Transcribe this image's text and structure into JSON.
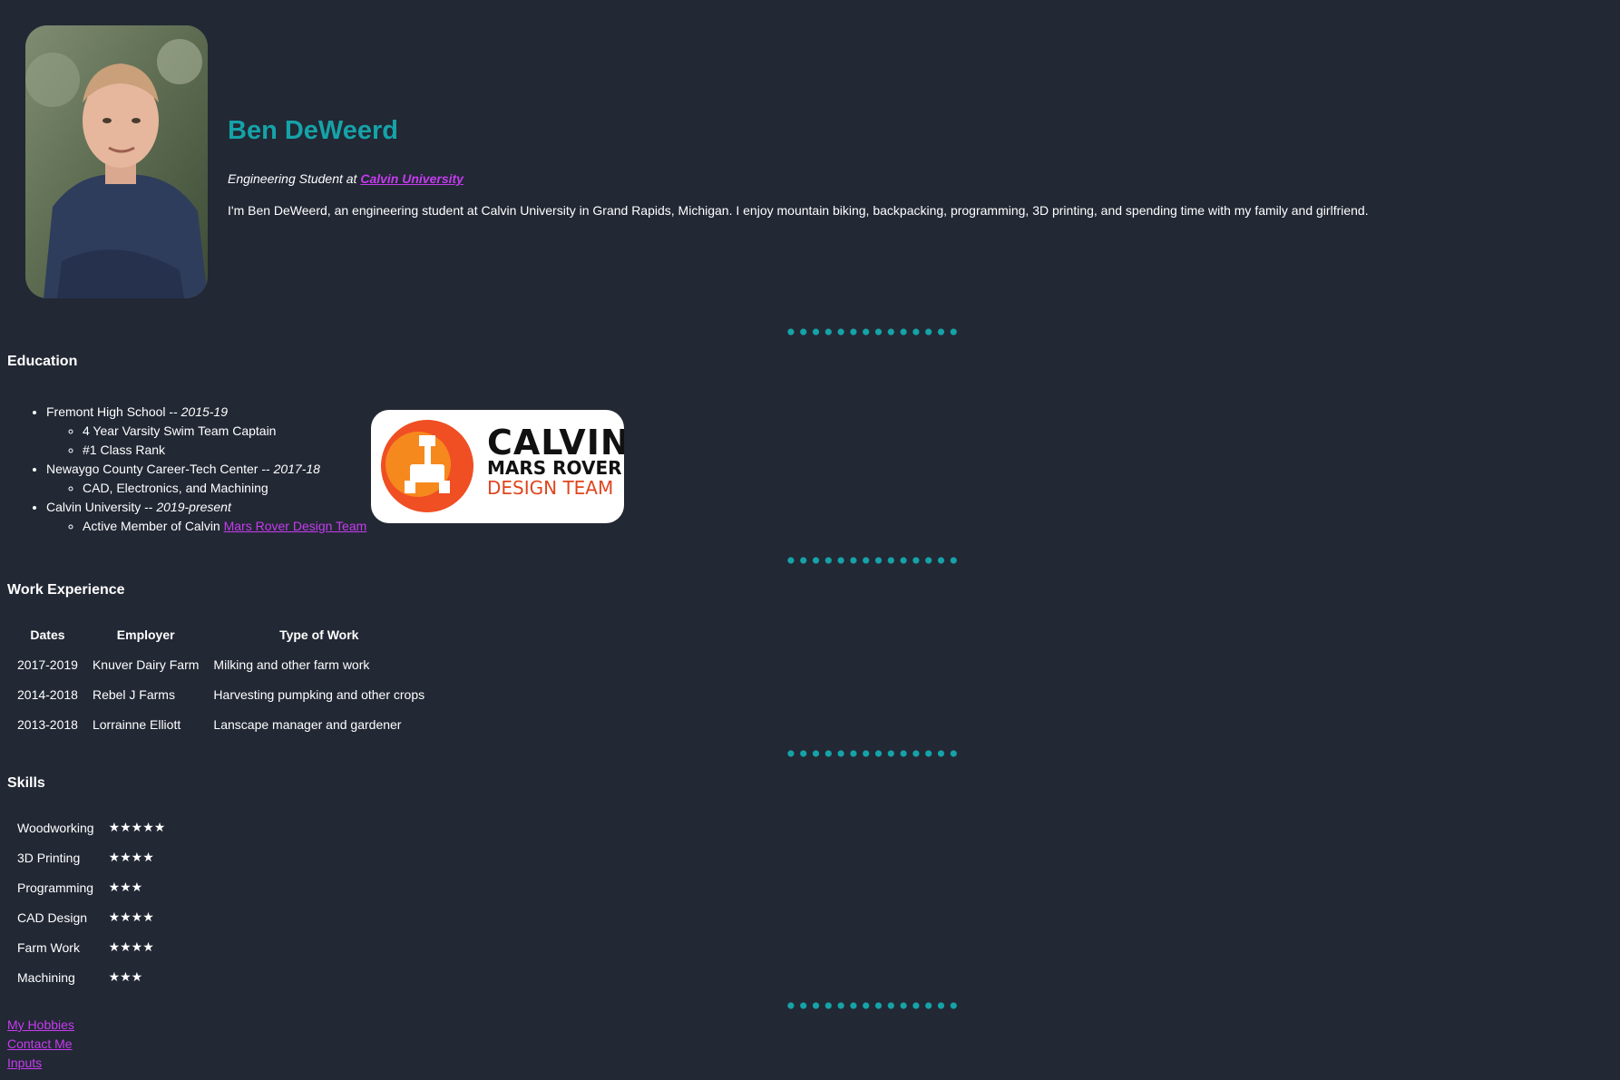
{
  "profile": {
    "name": "Ben DeWeerd",
    "subtitle_prefix": "Engineering Student at ",
    "subtitle_link": "Calvin University",
    "bio": "I'm Ben DeWeerd, an engineering student at Calvin University in Grand Rapids, Michigan. I enjoy mountain biking, backpacking, programming, 3D printing, and spending time with my family and girlfriend."
  },
  "education": {
    "title": "Education",
    "items": [
      {
        "school": "Fremont High School",
        "sep": " -- ",
        "dates": "2015-19",
        "sub": [
          "4 Year Varsity Swim Team Captain",
          "#1 Class Rank"
        ]
      },
      {
        "school": "Newaygo County Career-Tech Center",
        "sep": " -- ",
        "dates": "2017-18",
        "sub": [
          "CAD, Electronics, and Machining"
        ]
      },
      {
        "school": "Calvin University",
        "sep": " -- ",
        "dates": "2019-present",
        "sub_prefix": "Active Member of Calvin ",
        "sub_link": "Mars Rover Design Team"
      }
    ],
    "logo": {
      "line1": "CALVIN",
      "line2": "MARS ROVER",
      "line3": "DESIGN TEAM"
    }
  },
  "work": {
    "title": "Work Experience",
    "headers": [
      "Dates",
      "Employer",
      "Type of Work"
    ],
    "rows": [
      [
        "2017-2019",
        "Knuver Dairy Farm",
        "Milking and other farm work"
      ],
      [
        "2014-2018",
        "Rebel J Farms",
        "Harvesting pumpking and other crops"
      ],
      [
        "2013-2018",
        "Lorrainne Elliott",
        "Lanscape manager and gardener"
      ]
    ]
  },
  "skills": {
    "title": "Skills",
    "rows": [
      {
        "name": "Woodworking",
        "stars": "★★★★★",
        "rating": 5
      },
      {
        "name": "3D Printing",
        "stars": "★★★★",
        "rating": 4
      },
      {
        "name": "Programming",
        "stars": "★★★",
        "rating": 3
      },
      {
        "name": "CAD Design",
        "stars": "★★★★",
        "rating": 4
      },
      {
        "name": "Farm Work",
        "stars": "★★★★",
        "rating": 4
      },
      {
        "name": "Machining",
        "stars": "★★★",
        "rating": 3
      }
    ]
  },
  "links": [
    "My Hobbies",
    "Contact Me",
    "Inputs"
  ],
  "colors": {
    "background": "#222834",
    "accent": "#15a3a8",
    "link": "#c63cf0"
  },
  "icons": {
    "separator": "dotted-separator",
    "avatar": "profile-photo",
    "logo": "mars-rover-logo"
  }
}
